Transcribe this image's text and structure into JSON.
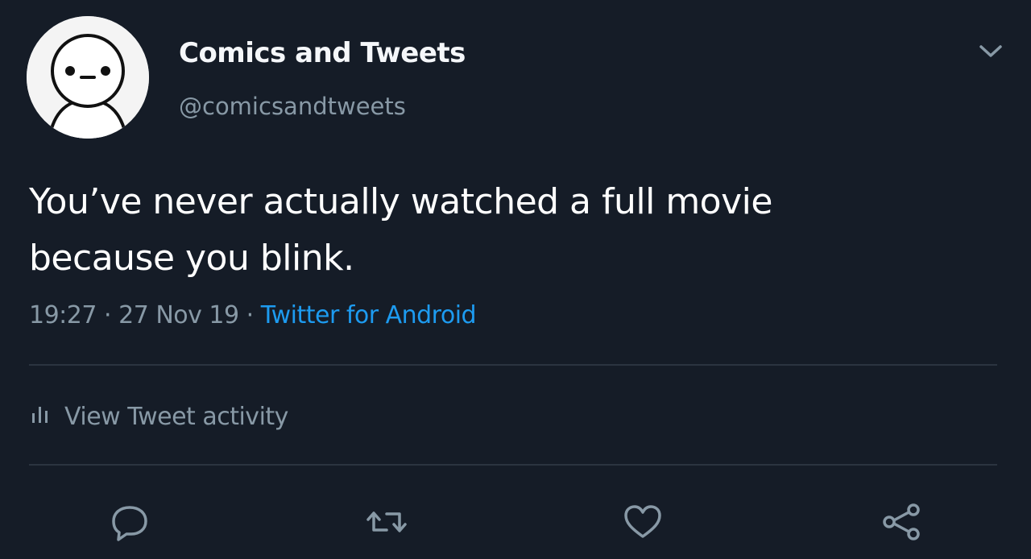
{
  "user": {
    "display_name": "Comics and Tweets",
    "handle": "@comicsandtweets"
  },
  "tweet": {
    "text_line1": "You’ve never actually watched a full movie",
    "text_line2": "because you blink.",
    "time": "19:27",
    "date": "27 Nov 19",
    "separator": "·",
    "source": "Twitter for Android"
  },
  "activity": {
    "label": "View Tweet activity"
  },
  "icons": {
    "avatar": "cartoon-avatar",
    "menu": "chevron-down-icon",
    "activity": "bar-chart-icon",
    "reply": "reply-icon",
    "retweet": "retweet-icon",
    "like": "heart-icon",
    "share": "share-icon"
  },
  "colors": {
    "background": "#151c27",
    "text": "#ffffff",
    "secondary": "#8899a6",
    "link": "#1d9bf0"
  }
}
